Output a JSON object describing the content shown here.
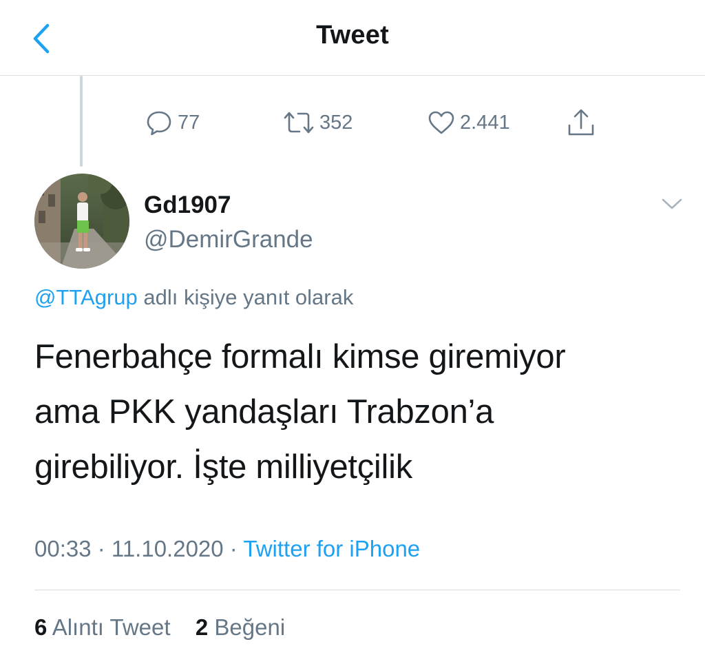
{
  "header": {
    "title": "Tweet",
    "back_icon": "chevron-left-icon",
    "accent_color": "#1da1f2"
  },
  "actions": {
    "replies": {
      "icon": "speech-bubble-icon",
      "count": "77"
    },
    "retweets": {
      "icon": "retweet-icon",
      "count": "352"
    },
    "likes": {
      "icon": "heart-icon",
      "count": "2.441"
    },
    "share": {
      "icon": "share-icon"
    }
  },
  "author": {
    "display_name": "Gd1907",
    "handle": "@DemirGrande",
    "menu_icon": "chevron-down-icon"
  },
  "reply_context": {
    "mention": "@TTAgrup",
    "suffix": " adlı kişiye yanıt olarak"
  },
  "tweet": {
    "lines": [
      "Fenerbahçe formalı kimse giremiyor",
      "ama PKK yandaşları Trabzon’a",
      "girebiliyor. İşte milliyetçilik"
    ]
  },
  "meta": {
    "time": "00:33",
    "separator": " · ",
    "date": "11.10.2020",
    "source": "Twitter for iPhone"
  },
  "stats": {
    "quotes_count": "6",
    "quotes_label": " Alıntı Tweet",
    "likes_count": "2",
    "likes_label": " Beğeni"
  },
  "colors": {
    "text": "#14171a",
    "secondary": "#657786",
    "link": "#1da1f2",
    "divider": "#d9dde1"
  }
}
